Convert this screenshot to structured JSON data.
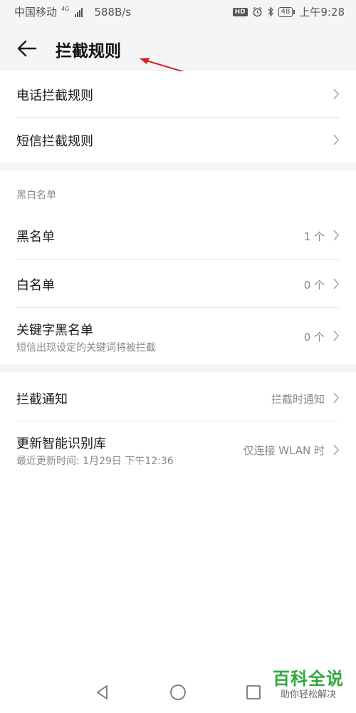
{
  "status_bar": {
    "carrier": "中国移动",
    "network": "4G",
    "speed": "588B/s",
    "hd": "HD",
    "battery": "48",
    "time": "上午9:28",
    "icons": [
      "signal-icon",
      "alarm-icon",
      "bluetooth-icon",
      "battery-icon"
    ]
  },
  "header": {
    "title": "拦截规则",
    "back_icon": "arrow-left-icon"
  },
  "annotation": {
    "color": "#d62020"
  },
  "sections": {
    "rules": {
      "items": [
        {
          "title": "电话拦截规则"
        },
        {
          "title": "短信拦截规则"
        }
      ]
    },
    "lists": {
      "header": "黑白名单",
      "items": [
        {
          "title": "黑名单",
          "value": "1 个"
        },
        {
          "title": "白名单",
          "value": "0 个"
        },
        {
          "title": "关键字黑名单",
          "subtitle": "短信出现设定的关键词将被拦截",
          "value": "0 个"
        }
      ]
    },
    "other": {
      "items": [
        {
          "title": "拦截通知",
          "value": "拦截时通知"
        },
        {
          "title": "更新智能识别库",
          "subtitle": "最近更新时间: 1月29日 下午12:36",
          "value": "仅连接 WLAN 时"
        }
      ]
    }
  },
  "navbar": {
    "icons": [
      "back-triangle-icon",
      "home-circle-icon",
      "recents-square-icon"
    ]
  },
  "watermark": {
    "logo": "百科全说",
    "tagline": "助你轻松解决",
    "color": "#2eaa3c"
  },
  "colors": {
    "background": "#f5f5f5",
    "card": "#ffffff",
    "primary_text": "#1a1a1a",
    "secondary_text": "#888888"
  }
}
